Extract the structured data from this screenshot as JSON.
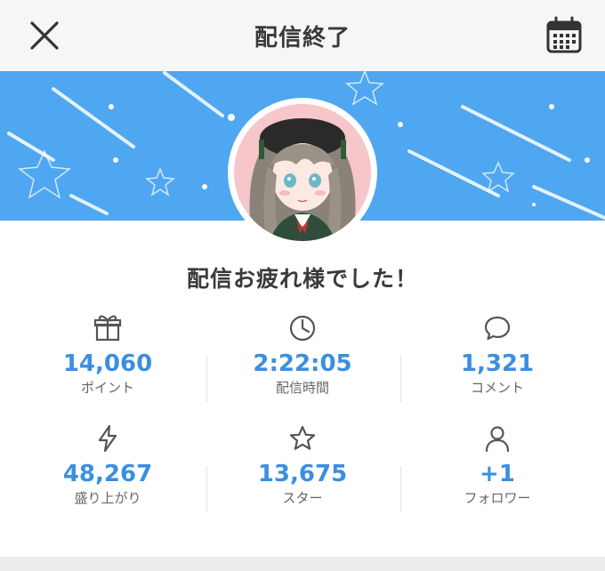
{
  "header": {
    "title": "配信終了",
    "close_icon": "close-icon",
    "calendar_icon": "calendar-icon"
  },
  "banner": {
    "color": "#4ea7f0"
  },
  "greeting": "配信お疲れ様でした！",
  "stats": [
    {
      "icon": "gift-icon",
      "value": "14,060",
      "label": "ポイント"
    },
    {
      "icon": "clock-icon",
      "value": "2:22:05",
      "label": "配信時間"
    },
    {
      "icon": "comment-icon",
      "value": "1,321",
      "label": "コメント"
    },
    {
      "icon": "lightning-icon",
      "value": "48,267",
      "label": "盛り上がり"
    },
    {
      "icon": "star-icon",
      "value": "13,675",
      "label": "スター"
    },
    {
      "icon": "person-icon",
      "value": "+1",
      "label": "フォロワー"
    }
  ],
  "colors": {
    "accent": "#3b8fe0",
    "text": "#3a3a3a",
    "label": "#666666"
  }
}
